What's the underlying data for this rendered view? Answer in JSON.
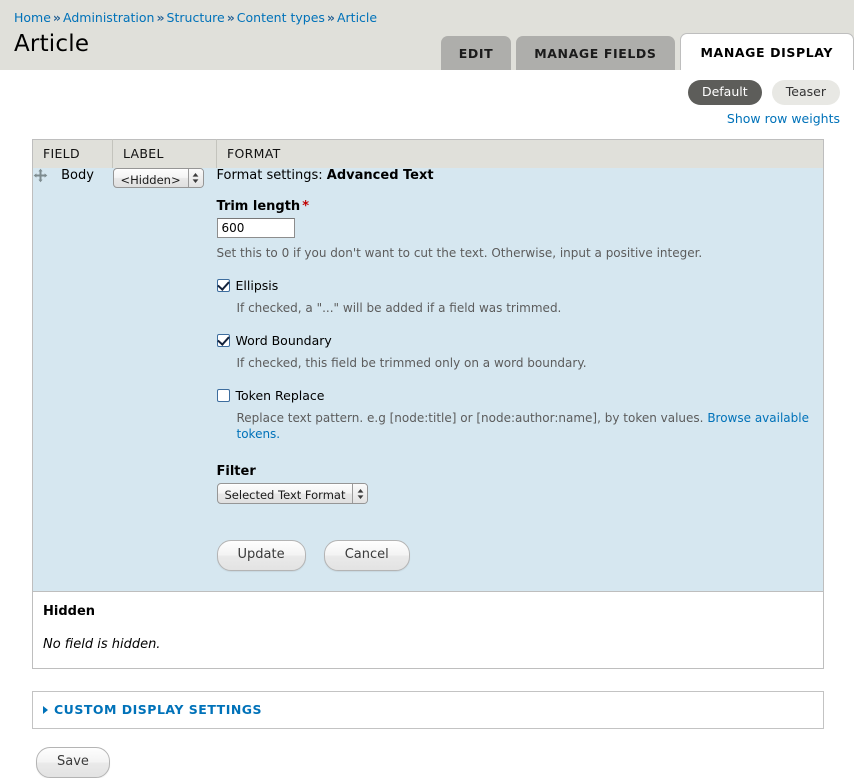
{
  "breadcrumb": {
    "separator": "»",
    "items": [
      {
        "label": "Home"
      },
      {
        "label": "Administration"
      },
      {
        "label": "Structure"
      },
      {
        "label": "Content types"
      },
      {
        "label": "Article"
      }
    ]
  },
  "page": {
    "title": "Article"
  },
  "tabs": [
    {
      "label": "EDIT",
      "active": false
    },
    {
      "label": "MANAGE FIELDS",
      "active": false
    },
    {
      "label": "MANAGE DISPLAY",
      "active": true
    }
  ],
  "view_modes": [
    {
      "label": "Default",
      "selected": true
    },
    {
      "label": "Teaser",
      "selected": false
    }
  ],
  "row_weights": {
    "label": "Show row weights"
  },
  "table": {
    "headers": {
      "field": "FIELD",
      "label": "LABEL",
      "format": "FORMAT"
    },
    "row": {
      "drag_handle_icon": "drag-cross-icon",
      "field_name": "Body",
      "label_select": {
        "value": "<Hidden>"
      }
    }
  },
  "format_settings": {
    "prefix": "Format settings: ",
    "formatter": "Advanced Text",
    "trim_length": {
      "label": "Trim length",
      "required_marker": "*",
      "value": "600",
      "description": "Set this to 0 if you don't want to cut the text. Otherwise, input a positive integer."
    },
    "ellipsis": {
      "label": "Ellipsis",
      "checked": true,
      "description": "If checked, a \"...\" will be added if a field was trimmed."
    },
    "word_boundary": {
      "label": "Word Boundary",
      "checked": true,
      "description": "If checked, this field be trimmed only on a word boundary."
    },
    "token_replace": {
      "label": "Token Replace",
      "checked": false,
      "description": "Replace text pattern. e.g [node:title] or [node:author:name], by token values. ",
      "link_text": "Browse available tokens."
    },
    "filter": {
      "label": "Filter",
      "value": "Selected Text Format"
    },
    "update_button": "Update",
    "cancel_button": "Cancel"
  },
  "hidden_region": {
    "title": "Hidden",
    "empty_text": "No field is hidden."
  },
  "custom_display_settings": {
    "legend": "CUSTOM DISPLAY SETTINGS"
  },
  "save_button": {
    "label": "Save"
  },
  "colors": {
    "link": "#0072b9",
    "header_band": "#e0e0da",
    "row_background": "#d6e7f0",
    "tab_inactive": "#aeaeab",
    "pill_selected_bg": "#5d5d5a",
    "required": "#c00000"
  }
}
